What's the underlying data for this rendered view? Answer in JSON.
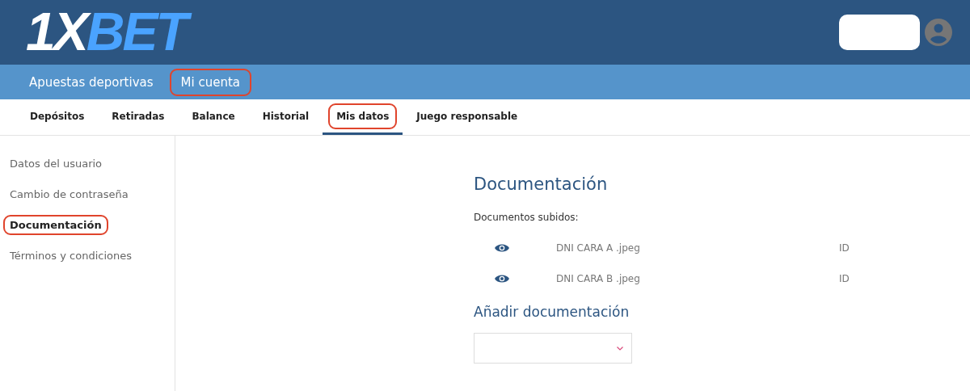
{
  "logo": {
    "parts": [
      {
        "text": "1X",
        "color": "#ffffff"
      },
      {
        "text": "BET",
        "color": "#4aa3ff"
      }
    ]
  },
  "main_nav": [
    {
      "label": "Apuestas deportivas",
      "highlighted": false
    },
    {
      "label": "Mi cuenta",
      "highlighted": true
    }
  ],
  "tabs": [
    {
      "label": "Depósitos",
      "selected": false,
      "highlighted": false
    },
    {
      "label": "Retiradas",
      "selected": false,
      "highlighted": false
    },
    {
      "label": "Balance",
      "selected": false,
      "highlighted": false
    },
    {
      "label": "Historial",
      "selected": false,
      "highlighted": false
    },
    {
      "label": "Mis datos",
      "selected": true,
      "highlighted": true
    },
    {
      "label": "Juego responsable",
      "selected": false,
      "highlighted": false
    }
  ],
  "sidebar": {
    "items": [
      {
        "label": "Datos del usuario",
        "selected": false,
        "highlighted": false
      },
      {
        "label": "Cambio de contraseña",
        "selected": false,
        "highlighted": false
      },
      {
        "label": "Documentación",
        "selected": true,
        "highlighted": true
      },
      {
        "label": "Términos y condiciones",
        "selected": false,
        "highlighted": false
      }
    ]
  },
  "content": {
    "title": "Documentación",
    "uploaded_label": "Documentos subidos:",
    "documents": [
      {
        "name": "DNI CARA A .jpeg",
        "type": "ID"
      },
      {
        "name": "DNI CARA B .jpeg",
        "type": "ID"
      }
    ],
    "add_title": "Añadir documentación"
  }
}
